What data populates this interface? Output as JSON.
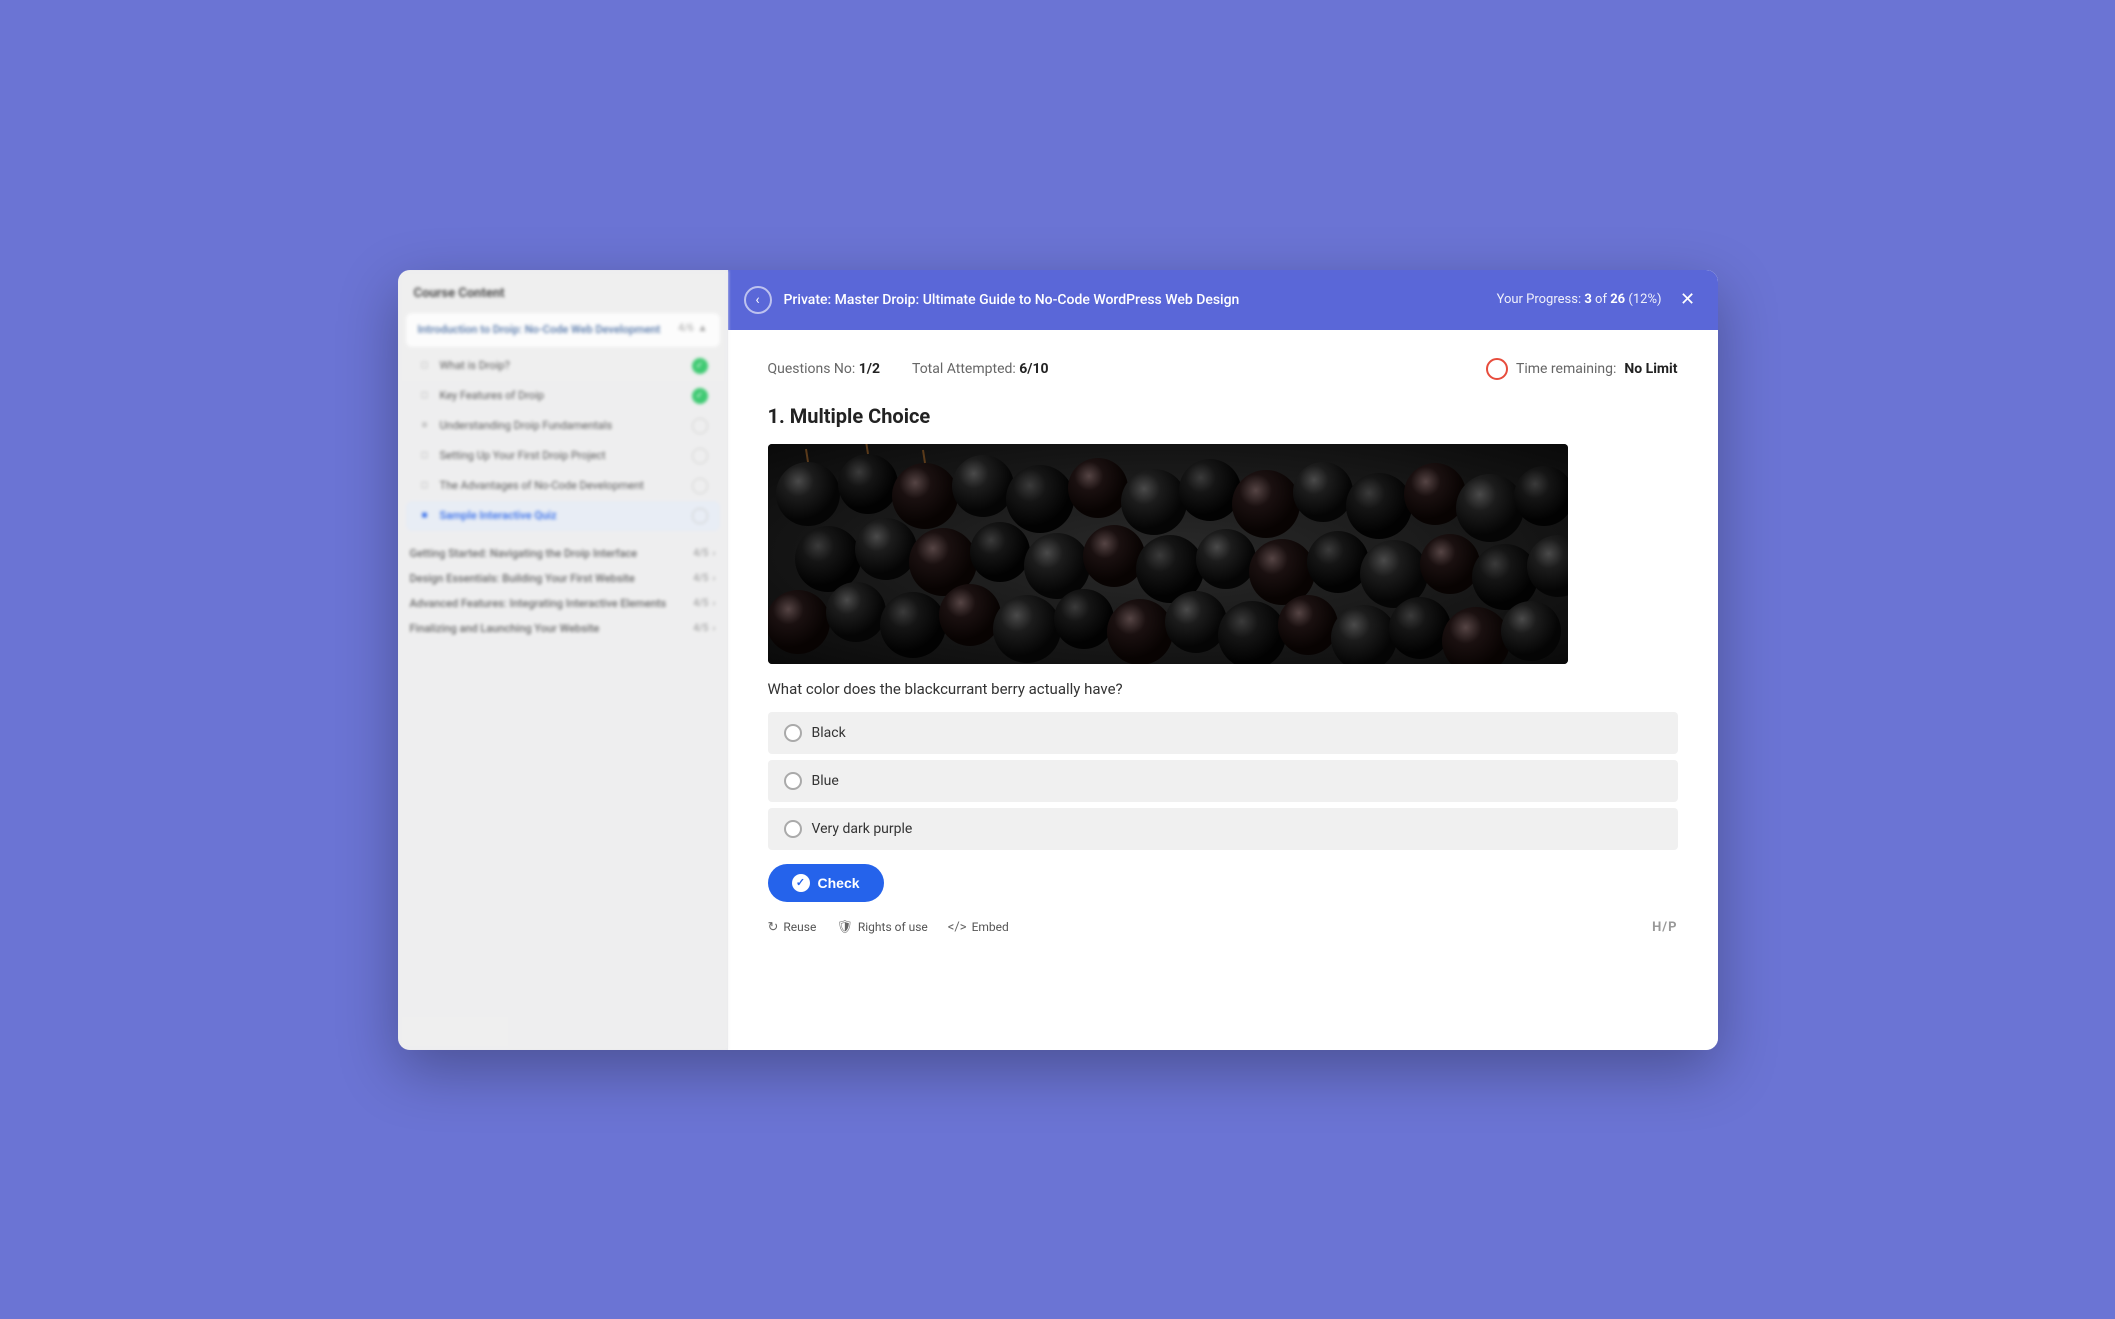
{
  "app": {
    "background_color": "#6b74d4"
  },
  "sidebar": {
    "title": "Course Content",
    "active_section": "Introduction to Droip: No-Code Web Development",
    "items_in_active_section": [
      {
        "label": "What is Droip?",
        "status": "done",
        "icon": "□"
      },
      {
        "label": "Key Features of Droip",
        "status": "done",
        "icon": "□"
      },
      {
        "label": "Understanding Droip Fundamentals",
        "status": "empty",
        "icon": "□"
      },
      {
        "label": "Setting Up Your First Droip Project",
        "status": "empty",
        "icon": "□"
      },
      {
        "label": "The Advantages of No-Code Development",
        "status": "empty",
        "icon": "□"
      },
      {
        "label": "Sample Interactive Quiz",
        "status": "active",
        "icon": "■"
      }
    ],
    "other_sections": [
      {
        "label": "Getting Started: Navigating the Droip Interface",
        "meta": "4/5",
        "expanded": false
      },
      {
        "label": "Design Essentials: Building Your First Website",
        "meta": "4/5",
        "expanded": false
      },
      {
        "label": "Advanced Features: Integrating Interactive Elements",
        "meta": "4/5",
        "expanded": false
      },
      {
        "label": "Finalizing and Launching Your Website",
        "meta": "4/5",
        "expanded": false
      }
    ]
  },
  "top_bar": {
    "back_icon": "‹",
    "title": "Private: Master Droip: Ultimate Guide to No-Code WordPress Web Design",
    "progress_label": "Your Progress:",
    "progress_current": "3",
    "progress_total": "26",
    "progress_percent": "12%",
    "close_icon": "✕"
  },
  "quiz": {
    "questions_no_label": "Questions No:",
    "questions_no_value": "1/2",
    "total_attempted_label": "Total Attempted:",
    "total_attempted_value": "6/10",
    "time_remaining_label": "Time remaining:",
    "time_remaining_value": "No Limit",
    "question_title": "1. Multiple Choice",
    "question_text": "What color does the blackcurrant berry actually have?",
    "options": [
      {
        "id": "opt-black",
        "label": "Black"
      },
      {
        "id": "opt-blue",
        "label": "Blue"
      },
      {
        "id": "opt-purple",
        "label": "Very dark purple"
      }
    ],
    "check_button_label": "Check"
  },
  "footer": {
    "reuse_label": "Reuse",
    "rights_label": "Rights of use",
    "embed_label": "Embed",
    "hp_logo": "H/P"
  }
}
